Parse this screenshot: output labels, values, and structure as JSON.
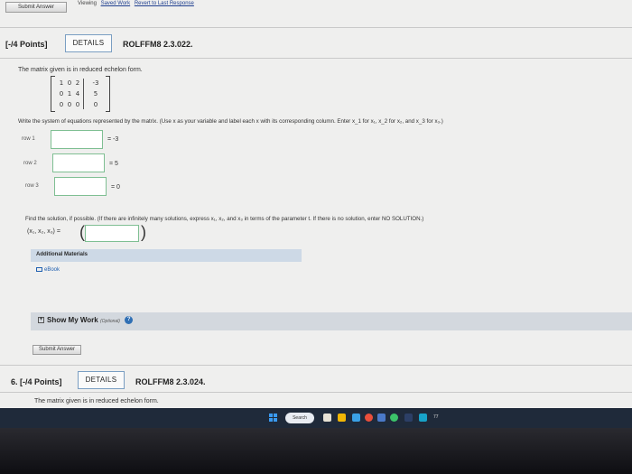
{
  "top": {
    "submit_label": "Submit Answer",
    "viewing": "Viewing",
    "saved_work": "Saved Work",
    "revert": "Revert to Last Response"
  },
  "question1": {
    "points": "[-/4 Points]",
    "details": "DETAILS",
    "code": "ROLFFM8 2.3.022.",
    "intro": "The matrix given is in reduced echelon form.",
    "matrix": [
      [
        "1",
        "0",
        "2",
        "-3"
      ],
      [
        "0",
        "1",
        "4",
        "5"
      ],
      [
        "0",
        "0",
        "0",
        "0"
      ]
    ],
    "instructions": "Write the system of equations represented by the matrix. (Use x as your variable and label each x with its corresponding column. Enter x_1 for x₁, x_2 for x₂, and x_3 for x₃.)",
    "rows": [
      {
        "label": "row 1",
        "rhs": "= -3",
        "value": ""
      },
      {
        "label": "row 2",
        "rhs": "= 5",
        "value": ""
      },
      {
        "label": "row 3",
        "rhs": "= 0",
        "value": ""
      }
    ],
    "solution_prompt": "Find the solution, if possible. (If there are infinitely many solutions, express x₁, x₂, and x₃ in terms of the parameter t. If there is no solution, enter NO SOLUTION.)",
    "solution_label": "(x₁, x₂, x₃) =",
    "additional_materials": "Additional Materials",
    "ebook": "eBook",
    "show_work": "Show My Work",
    "optional": "(Optional)",
    "help": "?",
    "submit_label": "Submit Answer"
  },
  "question2": {
    "number_points": "6.  [-/4 Points]",
    "details": "DETAILS",
    "code": "ROLFFM8 2.3.024.",
    "intro": "The matrix given is in reduced echelon form."
  },
  "taskbar": {
    "search": "Search",
    "clock": "77"
  }
}
